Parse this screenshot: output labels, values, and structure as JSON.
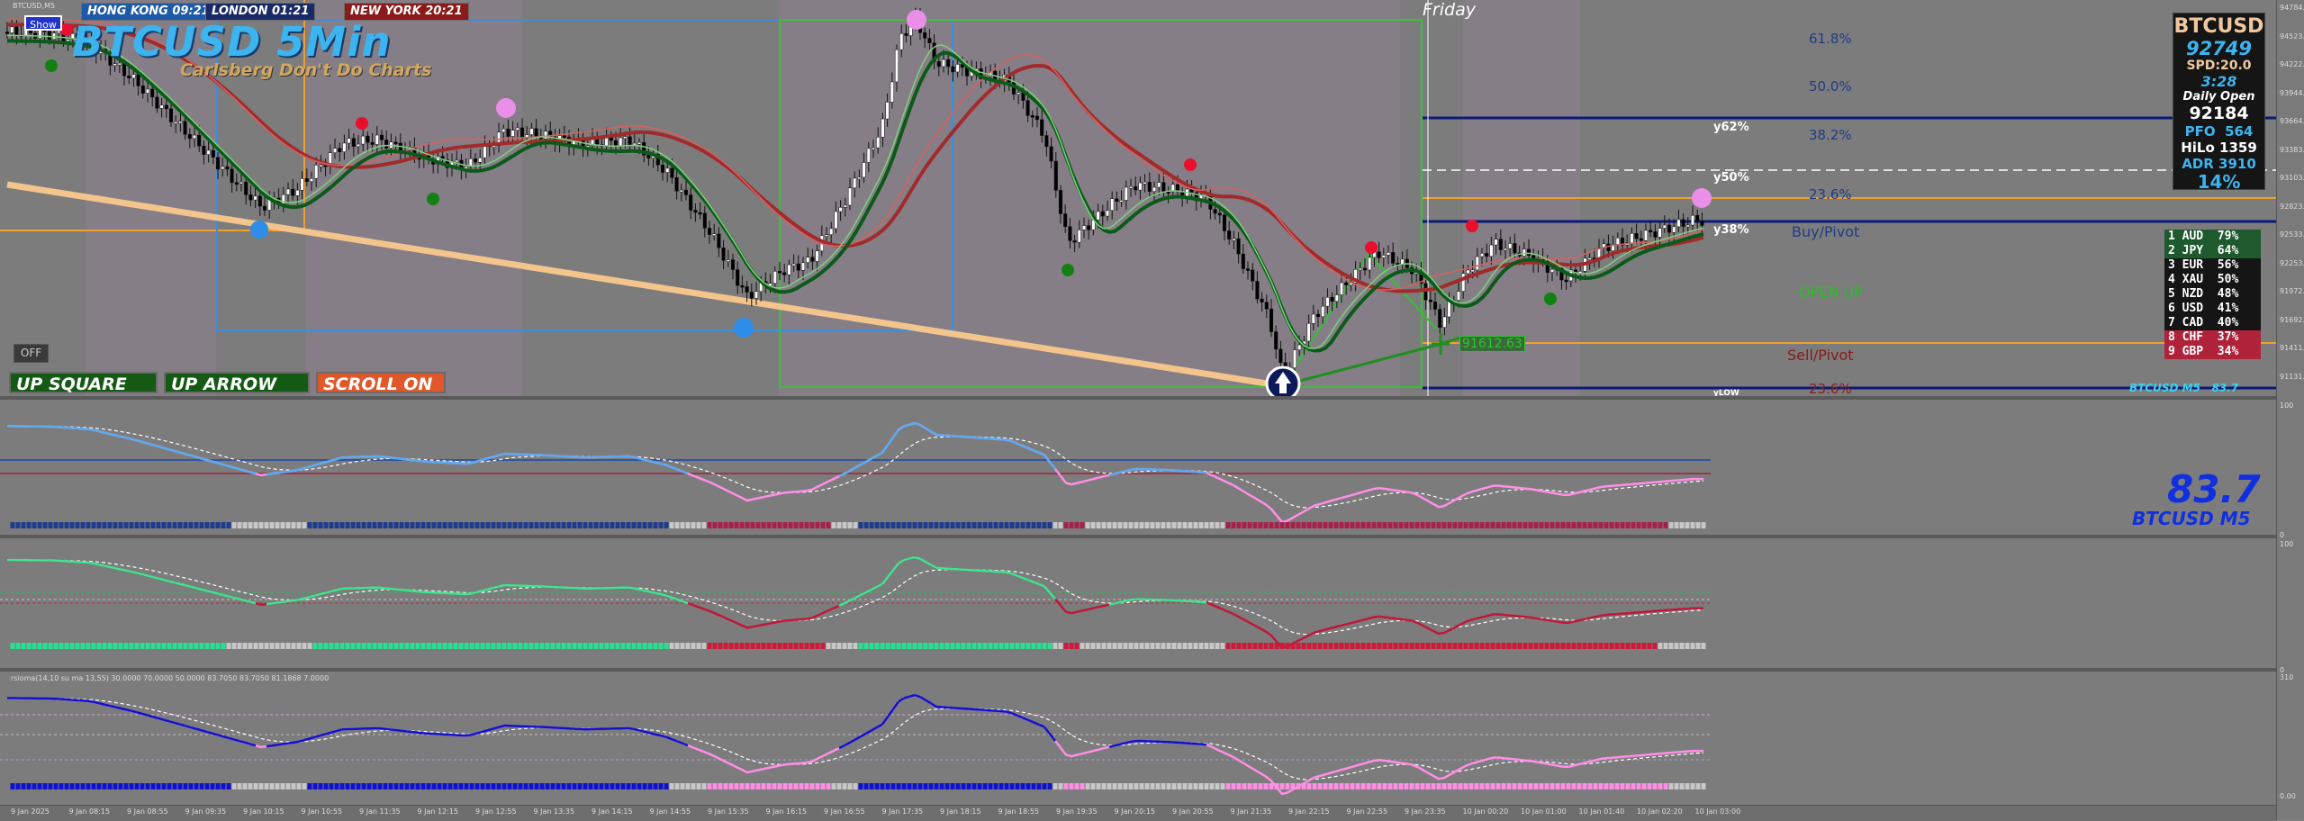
{
  "chart": {
    "symbol_tiny": "BTCUSD,M5",
    "title": "BTCUSD 5Min",
    "subtitle": "Carlsberg Don't Do Charts",
    "day_label": "Friday",
    "show_button": "Show",
    "off_button": "OFF",
    "clocks": [
      {
        "label": "HONG KONG 09:21",
        "color": "#1e5aa8"
      },
      {
        "label": "LONDON  01:21",
        "color": "#1a2a66"
      },
      {
        "label": "NEW YORK  20:21",
        "color": "#8b1a1a"
      }
    ],
    "buttons": {
      "up_square": "UP SQUARE",
      "up_arrow": "UP ARROW",
      "scroll_on": "SCROLL ON"
    },
    "price_marker": "91612.63",
    "fib_levels": [
      "61.8%",
      "50.0%",
      "38.2%",
      "23.6%",
      "23.6%"
    ],
    "y_levels": [
      "y62%",
      "y50%",
      "y38%",
      "yLOW"
    ],
    "pivot_labels": {
      "buy": "Buy/Pivot",
      "open": "OPEN UP",
      "sell": "Sell/Pivot"
    },
    "footer_tag": "BTCUSD M5   83.7"
  },
  "info_panel": {
    "symbol": "BTCUSD",
    "price": "92749",
    "spread": "SPD:20.0",
    "timer": "3:28",
    "daily_open_label": "Daily Open",
    "daily_open": "92184",
    "pfo_label": "PFO",
    "pfo": "564",
    "hilo_label": "HiLo",
    "hilo": "1359",
    "adr_label": "ADR",
    "adr": "3910",
    "adr_pct": "14%"
  },
  "currency_strength": [
    {
      "rank": "1",
      "ccy": "AUD",
      "pct": "79%",
      "bg": "#1e5a2e"
    },
    {
      "rank": "2",
      "ccy": "JPY",
      "pct": "64%",
      "bg": "#1e5a2e"
    },
    {
      "rank": "3",
      "ccy": "EUR",
      "pct": "56%",
      "bg": "#151515"
    },
    {
      "rank": "4",
      "ccy": "XAU",
      "pct": "50%",
      "bg": "#151515"
    },
    {
      "rank": "5",
      "ccy": "NZD",
      "pct": "48%",
      "bg": "#151515"
    },
    {
      "rank": "6",
      "ccy": "USD",
      "pct": "41%",
      "bg": "#151515"
    },
    {
      "rank": "7",
      "ccy": "CAD",
      "pct": "40%",
      "bg": "#151515"
    },
    {
      "rank": "8",
      "ccy": "CHF",
      "pct": "37%",
      "bg": "#b0223a"
    },
    {
      "rank": "9",
      "ccy": "GBP",
      "pct": "34%",
      "bg": "#b0223a"
    }
  ],
  "indicator1": {
    "value": "83.7",
    "label": "BTCUSD M5"
  },
  "indicator3": {
    "header": "rsioma(14,10 su ma 13,55) 30.0000 70.0000 50.0000 83.7050 83.7050 81.1868 7.0000"
  },
  "price_scale": [
    "94784.00",
    "94523.00",
    "94222.00",
    "93944.00",
    "93664.00",
    "93383.00",
    "93103.00",
    "92823.00",
    "92533.00",
    "92253.00",
    "91972.00",
    "91692.00",
    "91411.00",
    "91131.00"
  ],
  "indicator_scale": [
    "100",
    "0",
    "100",
    "0",
    "310",
    "0.00"
  ],
  "time_axis": [
    "9 Jan 2025",
    "9 Jan 08:15",
    "9 Jan 08:55",
    "9 Jan 09:35",
    "9 Jan 10:15",
    "9 Jan 10:55",
    "9 Jan 11:35",
    "9 Jan 12:15",
    "9 Jan 12:55",
    "9 Jan 13:35",
    "9 Jan 14:15",
    "9 Jan 14:55",
    "9 Jan 15:35",
    "9 Jan 16:15",
    "9 Jan 16:55",
    "9 Jan 17:35",
    "9 Jan 18:15",
    "9 Jan 18:55",
    "9 Jan 19:35",
    "9 Jan 20:15",
    "9 Jan 20:55",
    "9 Jan 21:35",
    "9 Jan 22:15",
    "9 Jan 22:55",
    "9 Jan 23:35",
    "10 Jan 00:20",
    "10 Jan 01:00",
    "10 Jan 01:40",
    "10 Jan 02:20",
    "10 Jan 03:00"
  ]
}
